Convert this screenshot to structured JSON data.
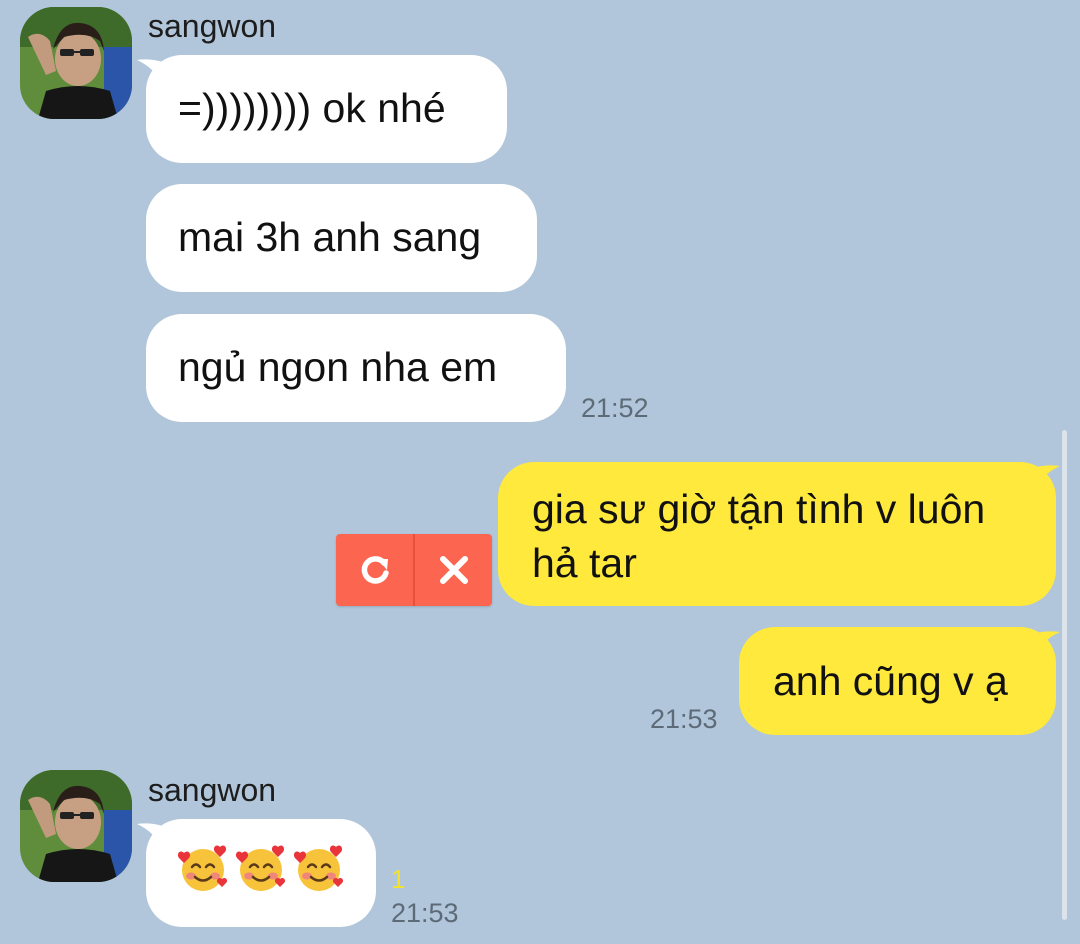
{
  "chat": {
    "messages": [
      {
        "sender": "sangwon",
        "direction": "in",
        "text": "=)))))))) ok nhé"
      },
      {
        "sender": "sangwon",
        "direction": "in",
        "text": "mai 3h anh sang"
      },
      {
        "sender": "sangwon",
        "direction": "in",
        "text": "ngủ ngon nha em",
        "time": "21:52"
      },
      {
        "direction": "out",
        "status": "failed",
        "text_line1": "gia sư giờ tận tình v luôn",
        "text_line2": "hả tar"
      },
      {
        "direction": "out",
        "text": "anh cũng v ạ",
        "time": "21:53"
      },
      {
        "sender": "sangwon",
        "direction": "in",
        "emoji": [
          "smiling-face-with-hearts",
          "smiling-face-with-hearts",
          "smiling-face-with-hearts"
        ],
        "unread_count": "1",
        "time": "21:53"
      }
    ],
    "failed_actions": {
      "retry_icon": "retry-icon",
      "delete_icon": "close-icon"
    }
  },
  "colors": {
    "background": "#b1c6da",
    "incoming_bubble": "#ffffff",
    "outgoing_bubble": "#fee93c",
    "failed_action": "#fc6650",
    "unread": "#f3e12f"
  }
}
